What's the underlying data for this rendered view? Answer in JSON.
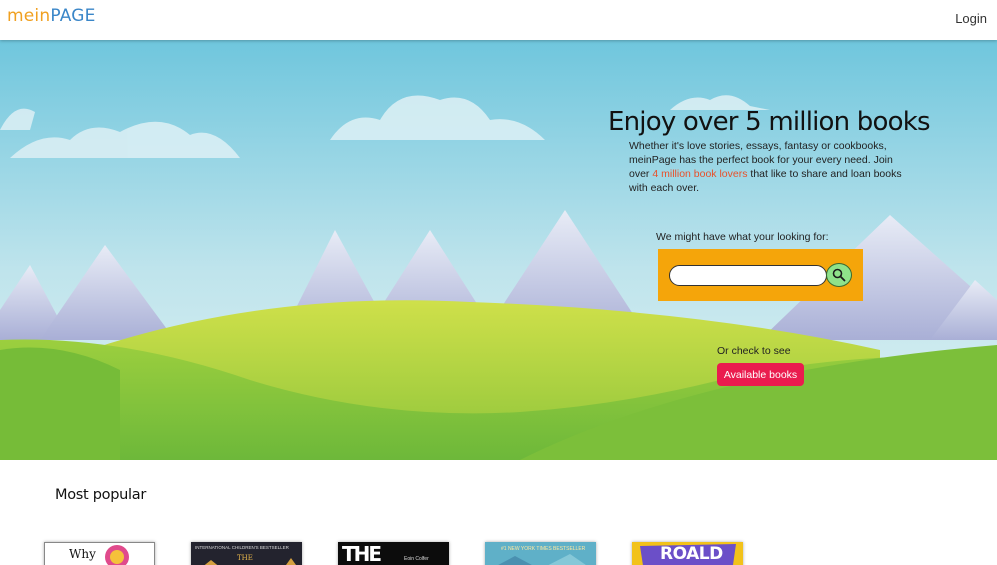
{
  "navbar": {
    "logo_part1": "mein",
    "logo_part2": "PAGE",
    "login_label": "Login"
  },
  "hero": {
    "headline": "Enjoy over 5 million books",
    "intro_text1": "Whether it's love stories, essays, fantasy or cookbooks, meinPage has the perfect book for your every need.",
    "intro_text2": "Join over",
    "intro_highlight": "4 million book lovers",
    "intro_text3": "that like to share and loan books with each over.",
    "search_label": "We might have what your looking for:",
    "search_value": "",
    "search_button_icon": "search-icon",
    "or_check_label": "Or check to see",
    "available_button_label": "Available books"
  },
  "most_popular": {
    "title": "Most popular",
    "books": [
      {
        "cover_text": "Why"
      },
      {
        "cover_text": "INTERNATIONAL CHILDREN'S BESTSELLER",
        "cover_text2": "THE"
      },
      {
        "cover_text": "THE",
        "cover_text2": "Eoin Colfer"
      },
      {
        "cover_text": "#1 NEW YORK TIMES BESTSELLER"
      },
      {
        "cover_text": "ROALD"
      }
    ]
  },
  "colors": {
    "logo_orange": "#f0a020",
    "logo_blue": "#3a86c8",
    "search_panel": "#f5a50a",
    "search_button": "#8fe28a",
    "cta": "#ea1c4e",
    "highlight": "#e8502a"
  }
}
